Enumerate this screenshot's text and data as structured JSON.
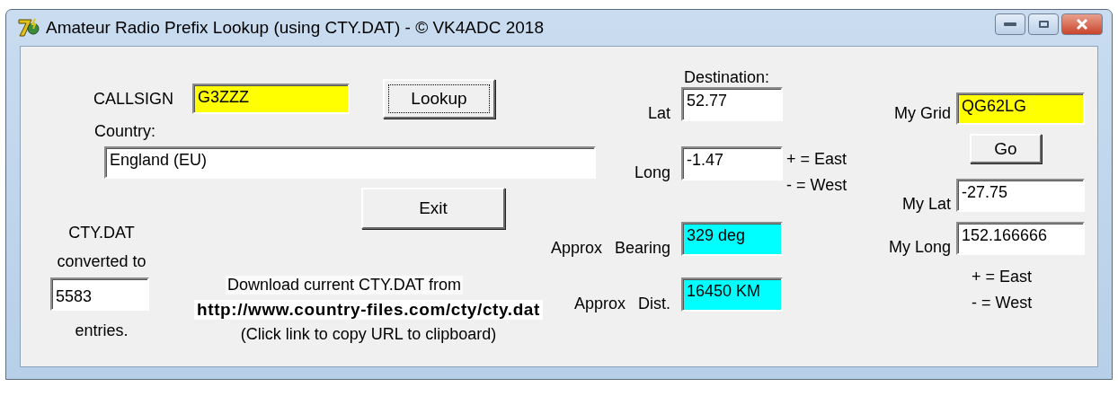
{
  "window": {
    "title": "Amateur Radio Prefix Lookup (using CTY.DAT) - © VK4ADC 2018"
  },
  "lookup": {
    "callsign_label": "CALLSIGN",
    "callsign": {
      "value": "G3ZZZ",
      "color": "#ffff00"
    },
    "lookup_button": {
      "label": "Lookup",
      "focused": true
    },
    "country_label": "Country:",
    "country": "England (EU)",
    "exit_button": "Exit"
  },
  "cty": {
    "lines": [
      "CTY.DAT",
      "converted to"
    ],
    "entries": "5583",
    "entries_label": "entries.",
    "download_text": "Download current CTY.DAT from",
    "url": "http://www.country-files.com/cty/cty.dat",
    "hint": "(Click link to copy URL to clipboard)"
  },
  "destination": {
    "title": "Destination:",
    "rows": [
      {
        "label": "Lat",
        "value": "52.77",
        "color": "#ffffff"
      },
      {
        "label": "Long",
        "value": "-1.47",
        "color": "#ffffff",
        "notes": [
          "+ = East",
          "- = West"
        ]
      },
      {
        "prefix": "Approx",
        "label": "Bearing",
        "value": "329 deg",
        "color": "#00ffff"
      },
      {
        "prefix": "Approx",
        "label": "Dist.",
        "value": "16450 KM",
        "color": "#00ffff"
      }
    ]
  },
  "home": {
    "grid_label": "My Grid",
    "grid": {
      "value": "QG62LG",
      "color": "#ffff00"
    },
    "go_button": "Go",
    "rows": [
      {
        "label": "My Lat",
        "value": "-27.75"
      },
      {
        "label": "My Long",
        "value": "152.166666"
      }
    ],
    "notes": [
      "+ = East",
      "- = West"
    ]
  }
}
